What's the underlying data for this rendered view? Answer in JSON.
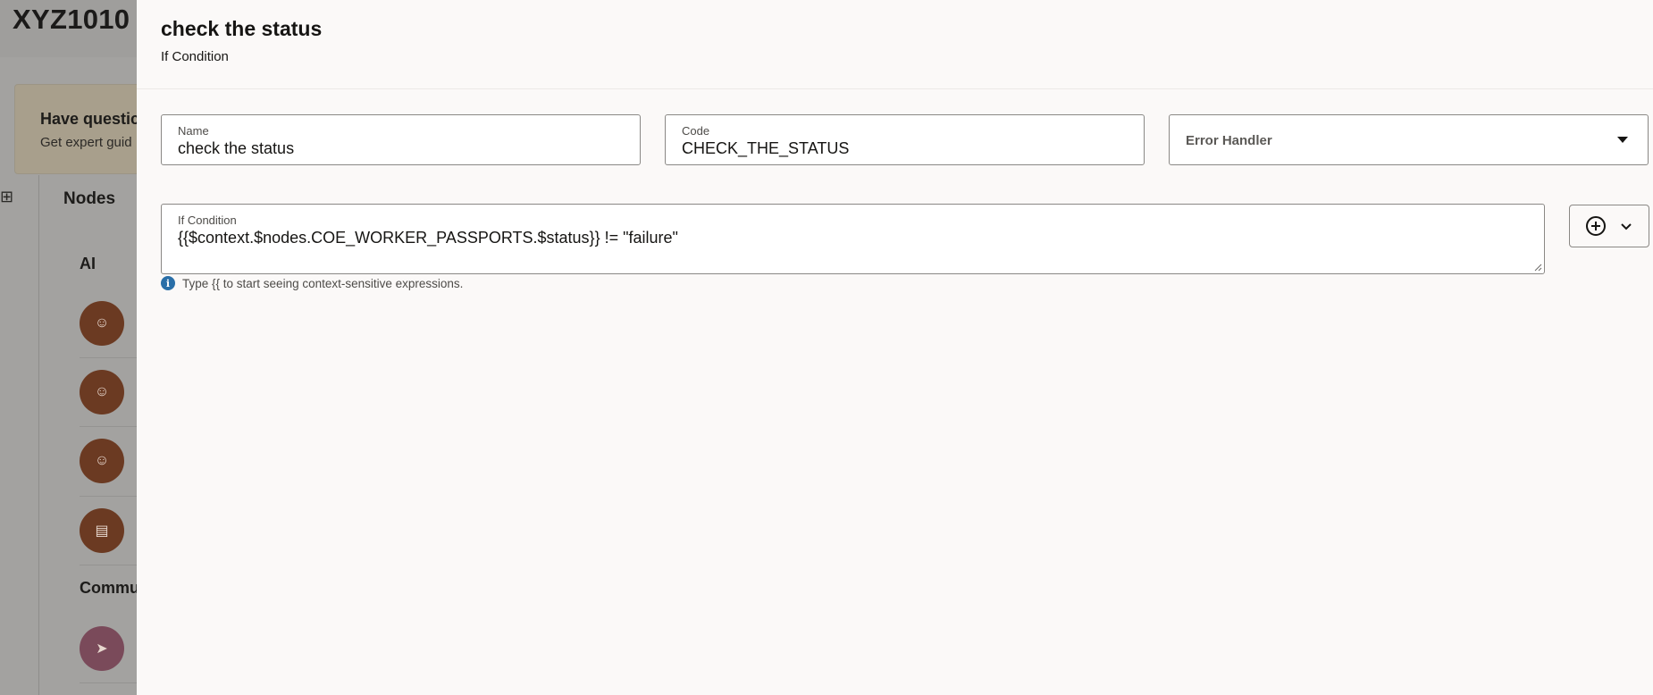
{
  "background": {
    "page_title": "XYZ1010",
    "banner": {
      "title": "Have questic",
      "subtitle": "Get expert guid"
    },
    "nodes_title": "Nodes",
    "sections": [
      {
        "label": "AI"
      },
      {
        "label": "Commu"
      }
    ],
    "icons": [
      "add-node-icon",
      "robot-icon",
      "robot-icon",
      "robot-icon",
      "document-icon",
      "send-icon"
    ]
  },
  "drawer": {
    "title": "check the status",
    "subtitle": "If Condition",
    "name_field": {
      "label": "Name",
      "value": "check the status"
    },
    "code_field": {
      "label": "Code",
      "value": "CHECK_THE_STATUS"
    },
    "error_handler": {
      "placeholder": "Error Handler"
    },
    "condition_field": {
      "label": "If Condition",
      "value": "{{$context.$nodes.COE_WORKER_PASSPORTS.$status}}  != \"failure\""
    },
    "hint": "Type {{ to start seeing context-sensitive expressions.",
    "colors": {
      "info": "#2a6fa8",
      "node_brown": "#6b3a22",
      "node_pink": "#7a4a5a"
    }
  }
}
